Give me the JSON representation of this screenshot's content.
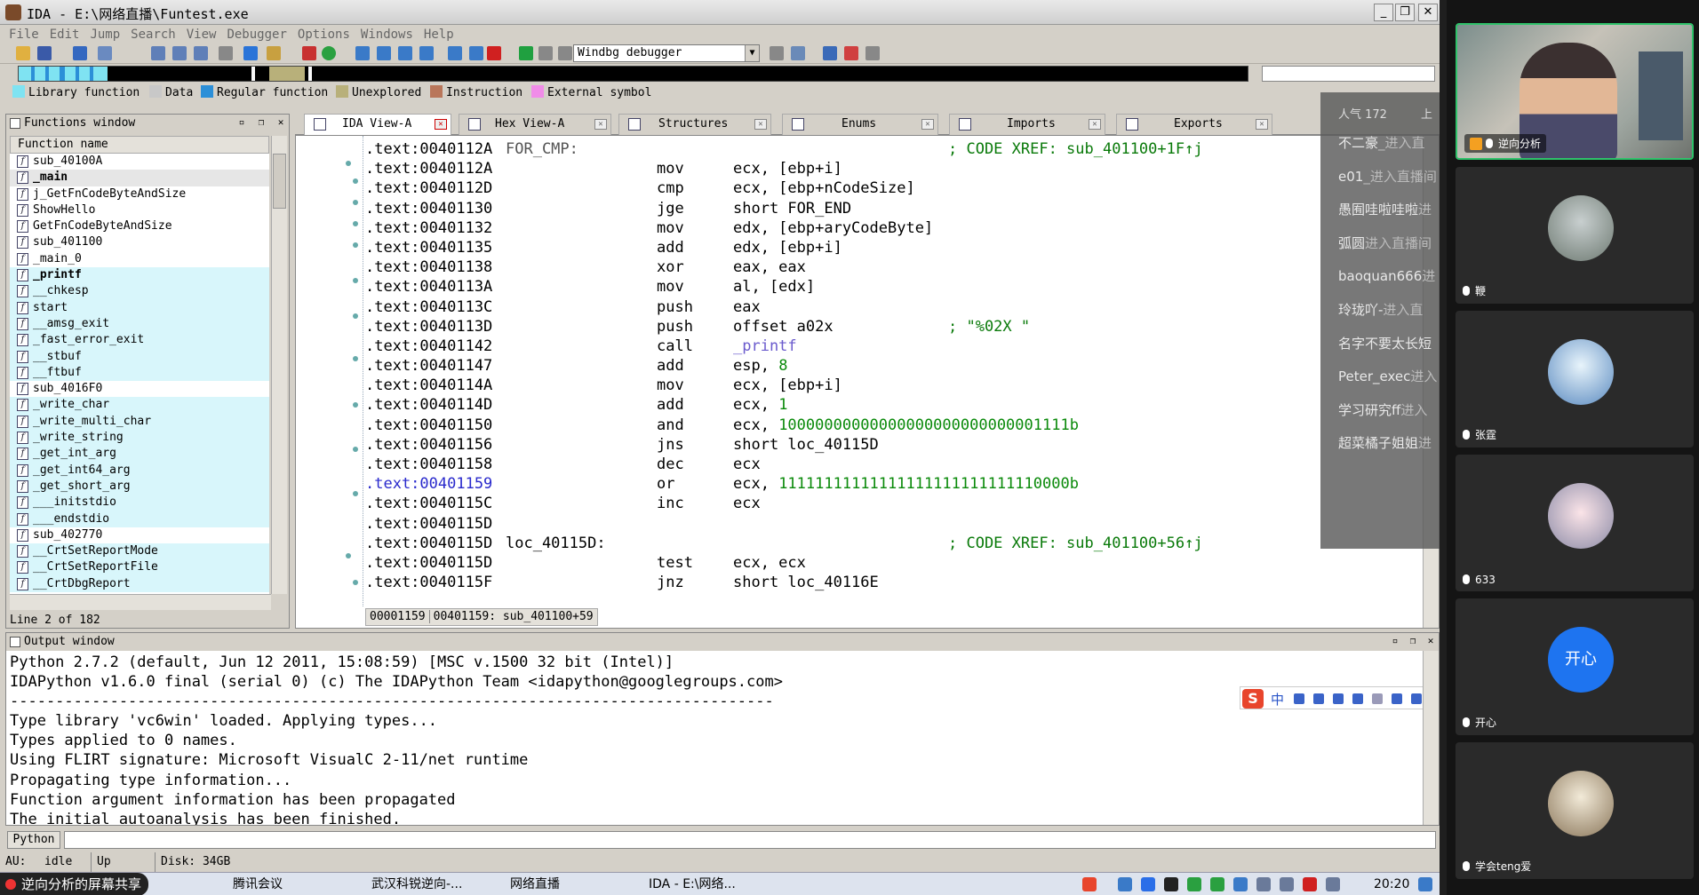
{
  "window": {
    "title": "IDA - E:\\网络直播\\Funtest.exe"
  },
  "menu": [
    "File",
    "Edit",
    "Jump",
    "Search",
    "View",
    "Debugger",
    "Options",
    "Windows",
    "Help"
  ],
  "toolbar": {
    "debugger": "Windbg debugger"
  },
  "legend": [
    {
      "label": "Library function",
      "color": "#7fe3f2"
    },
    {
      "label": "Data",
      "color": "#c8c8c8"
    },
    {
      "label": "Regular function",
      "color": "#2b8fd8"
    },
    {
      "label": "Unexplored",
      "color": "#b8b07a"
    },
    {
      "label": "Instruction",
      "color": "#b9765a"
    },
    {
      "label": "External symbol",
      "color": "#f08ce8"
    }
  ],
  "functions_window": {
    "title": "Functions window",
    "column": "Function name",
    "status": "Line 2 of 182",
    "items": [
      {
        "name": "sub_40100A",
        "kind": "reg"
      },
      {
        "name": "_main",
        "kind": "sel"
      },
      {
        "name": "j_GetFnCodeByteAndSize",
        "kind": "reg"
      },
      {
        "name": "ShowHello",
        "kind": "reg"
      },
      {
        "name": "GetFnCodeByteAndSize",
        "kind": "reg"
      },
      {
        "name": "sub_401100",
        "kind": "reg"
      },
      {
        "name": "_main_0",
        "kind": "reg"
      },
      {
        "name": "_printf",
        "kind": "libbold"
      },
      {
        "name": "__chkesp",
        "kind": "lib"
      },
      {
        "name": "start",
        "kind": "lib"
      },
      {
        "name": "__amsg_exit",
        "kind": "lib"
      },
      {
        "name": "_fast_error_exit",
        "kind": "lib"
      },
      {
        "name": "__stbuf",
        "kind": "lib"
      },
      {
        "name": "__ftbuf",
        "kind": "lib"
      },
      {
        "name": "sub_4016F0",
        "kind": "reg"
      },
      {
        "name": "_write_char",
        "kind": "lib"
      },
      {
        "name": "_write_multi_char",
        "kind": "lib"
      },
      {
        "name": "_write_string",
        "kind": "lib"
      },
      {
        "name": "_get_int_arg",
        "kind": "lib"
      },
      {
        "name": "_get_int64_arg",
        "kind": "lib"
      },
      {
        "name": "_get_short_arg",
        "kind": "lib"
      },
      {
        "name": "___initstdio",
        "kind": "lib"
      },
      {
        "name": "___endstdio",
        "kind": "lib"
      },
      {
        "name": "sub_402770",
        "kind": "reg"
      },
      {
        "name": "__CrtSetReportMode",
        "kind": "lib"
      },
      {
        "name": "__CrtSetReportFile",
        "kind": "lib"
      },
      {
        "name": "__CrtDbgReport",
        "kind": "lib"
      }
    ]
  },
  "tabs": [
    {
      "label": "IDA View-A",
      "active": true
    },
    {
      "label": "Hex View-A",
      "active": false
    },
    {
      "label": "Structures",
      "active": false
    },
    {
      "label": "Enums",
      "active": false
    },
    {
      "label": "Imports",
      "active": false
    },
    {
      "label": "Exports",
      "active": false
    }
  ],
  "code": {
    "status_left": "00001159",
    "status_right": "00401159: sub_401100+59",
    "lines": [
      {
        "addr": ".text:0040112A",
        "label": "FOR_CMP:",
        "label_grey": true,
        "mn": "",
        "op": "",
        "xref": "; CODE XREF: sub_401100+1F↑j"
      },
      {
        "addr": ".text:0040112A",
        "label": "",
        "mn": "mov",
        "op": "ecx, [ebp+i]"
      },
      {
        "addr": ".text:0040112D",
        "label": "",
        "mn": "cmp",
        "op": "ecx, [ebp+nCodeSize]"
      },
      {
        "addr": ".text:00401130",
        "label": "",
        "mn": "jge",
        "op": "short FOR_END"
      },
      {
        "addr": ".text:00401132",
        "label": "",
        "mn": "mov",
        "op": "edx, [ebp+aryCodeByte]"
      },
      {
        "addr": ".text:00401135",
        "label": "",
        "mn": "add",
        "op": "edx, [ebp+i]"
      },
      {
        "addr": ".text:00401138",
        "label": "",
        "mn": "xor",
        "op": "eax, eax"
      },
      {
        "addr": ".text:0040113A",
        "label": "",
        "mn": "mov",
        "op": "al, [edx]"
      },
      {
        "addr": ".text:0040113C",
        "label": "",
        "mn": "push",
        "op": "eax"
      },
      {
        "addr": ".text:0040113D",
        "label": "",
        "mn": "push",
        "op": "offset a02x",
        "comment": "; \"%02X \""
      },
      {
        "addr": ".text:00401142",
        "label": "",
        "mn": "call",
        "op": "_printf",
        "op_fn": true
      },
      {
        "addr": ".text:00401147",
        "label": "",
        "mn": "add",
        "op": "esp, 8"
      },
      {
        "addr": ".text:0040114A",
        "label": "",
        "mn": "mov",
        "op": "ecx, [ebp+i]"
      },
      {
        "addr": ".text:0040114D",
        "label": "",
        "mn": "add",
        "op": "ecx, 1"
      },
      {
        "addr": ".text:00401150",
        "label": "",
        "mn": "and",
        "op": "ecx, 10000000000000000000000000001111b"
      },
      {
        "addr": ".text:00401156",
        "label": "",
        "mn": "jns",
        "op": "short loc_40115D"
      },
      {
        "addr": ".text:00401158",
        "label": "",
        "mn": "dec",
        "op": "ecx"
      },
      {
        "addr": ".text:00401159",
        "label": "",
        "mn": "or",
        "op": "ecx, 11111111111111111111111111110000b",
        "hl": true
      },
      {
        "addr": ".text:0040115C",
        "label": "",
        "mn": "inc",
        "op": "ecx"
      },
      {
        "addr": ".text:0040115D",
        "label": "",
        "mn": "",
        "op": ""
      },
      {
        "addr": ".text:0040115D",
        "label": "loc_40115D:",
        "mn": "",
        "op": "",
        "xref": "; CODE XREF: sub_401100+56↑j"
      },
      {
        "addr": ".text:0040115D",
        "label": "",
        "mn": "test",
        "op": "ecx, ecx"
      },
      {
        "addr": ".text:0040115F",
        "label": "",
        "mn": "jnz",
        "op": "short loc_40116E"
      }
    ]
  },
  "chat": {
    "top_left": "人气 172",
    "top_right": "上",
    "lines": [
      {
        "user": "不二豪",
        "text": "_进入直"
      },
      {
        "user": "e01",
        "text": "_进入直播间"
      },
      {
        "user": "愚囿哇啦哇啦",
        "text": "进"
      },
      {
        "user": "弧圆",
        "text": "进入直播间"
      },
      {
        "user": "baoquan666",
        "text": "进"
      },
      {
        "user": "玲珑吖-",
        "text": "进入直"
      },
      {
        "user": "名字不要太长短",
        "text": ""
      },
      {
        "user": "Peter_exec",
        "text": "进入"
      },
      {
        "user": "学习研究ff",
        "text": "进入"
      },
      {
        "user": "超菜橘子姐姐",
        "text": "进"
      }
    ]
  },
  "output_window": {
    "title": "Output window",
    "lines": [
      "Python 2.7.2 (default, Jun 12 2011, 15:08:59) [MSC v.1500 32 bit (Intel)]",
      "IDAPython v1.6.0 final (serial 0) (c) The IDAPython Team <idapython@googlegroups.com>",
      "------------------------------------------------------------------------------------",
      "Type library 'vc6win' loaded. Applying types...",
      "Types applied to 0 names.",
      "Using FLIRT signature: Microsoft VisualC 2-11/net runtime",
      "Propagating type information...",
      "Function argument information has been propagated",
      "The initial autoanalysis has been finished."
    ],
    "ime_text": "中"
  },
  "python_bar": {
    "label": "Python"
  },
  "statusbar": {
    "au": "AU:",
    "state": "idle",
    "dir": "Up",
    "disk": "Disk: 34GB"
  },
  "taskbar": {
    "share": "逆向分析的屏幕共享",
    "items": [
      {
        "label": "腾讯会议",
        "color": "#2a6ee8"
      },
      {
        "label": "武汉科锐逆向-...",
        "color": "#6a7a9a"
      },
      {
        "label": "网络直播",
        "color": "#e8c24a"
      },
      {
        "label": "IDA - E:\\网络...",
        "color": "#7a4a2a"
      }
    ],
    "clock": "20:20"
  },
  "participants": [
    {
      "name": "逆向分析",
      "video": true,
      "active": true
    },
    {
      "name": "鞭",
      "avatar_color": "#8a8a7a"
    },
    {
      "name": "张霆",
      "avatar_color": "#6aa6d8"
    },
    {
      "name": "633",
      "avatar_color": "#f3d6dc"
    },
    {
      "name": "开心",
      "avatar_color": "#1e74f0",
      "avatar_text": "开心"
    },
    {
      "name": "学会teng爱",
      "avatar_color": "#c9b49a"
    }
  ]
}
